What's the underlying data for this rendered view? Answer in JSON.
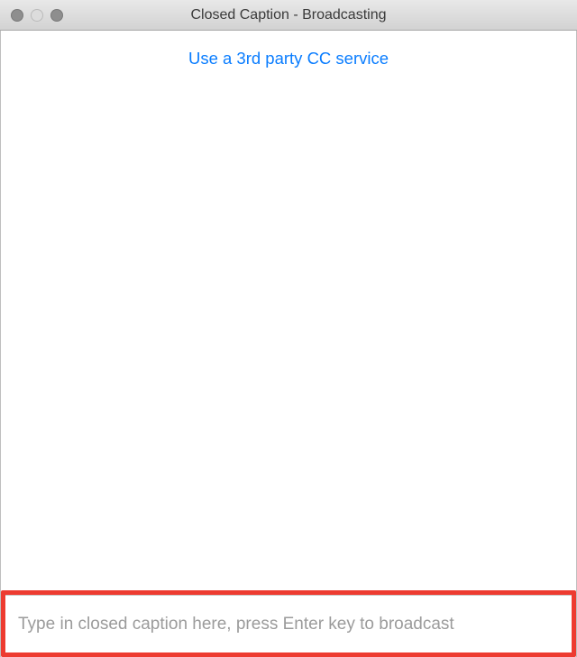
{
  "window": {
    "title": "Closed Caption - Broadcasting"
  },
  "header": {
    "link_label": "Use a 3rd party CC service"
  },
  "input": {
    "value": "",
    "placeholder": "Type in closed caption here, press Enter key to broadcast"
  },
  "highlight": {
    "color": "#ed3b30"
  }
}
